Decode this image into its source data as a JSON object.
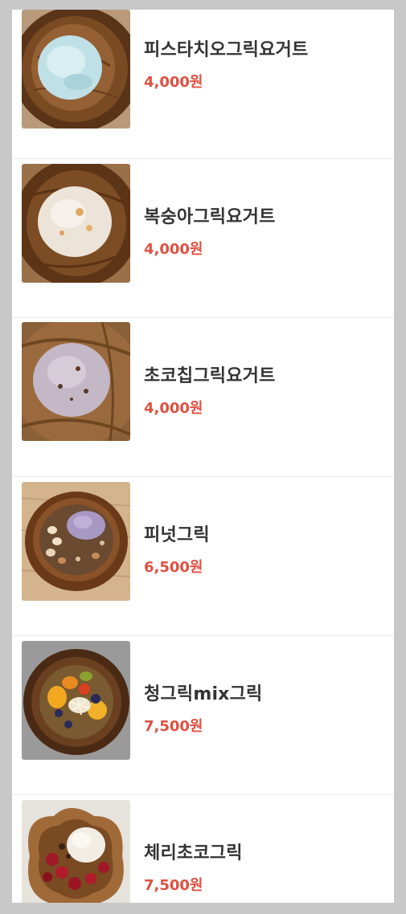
{
  "menu": {
    "items": [
      {
        "name": "피스타치오그릭요거트",
        "price": "4,000원",
        "image": "pistachio-greek-yogurt-photo"
      },
      {
        "name": "복숭아그릭요거트",
        "price": "4,000원",
        "image": "peach-greek-yogurt-photo"
      },
      {
        "name": "초코칩그릭요거트",
        "price": "4,000원",
        "image": "chocochip-greek-yogurt-photo"
      },
      {
        "name": "피넛그릭",
        "price": "6,500원",
        "image": "peanut-greek-photo"
      },
      {
        "name": "청그릭mix그릭",
        "price": "7,500원",
        "image": "cheong-greek-mix-photo"
      },
      {
        "name": "체리초코그릭",
        "price": "7,500원",
        "image": "cherry-choco-greek-photo"
      }
    ]
  },
  "colors": {
    "price": "#e05040",
    "name": "#333333",
    "background": "#ffffff",
    "overlay": "#c8c8c8"
  }
}
